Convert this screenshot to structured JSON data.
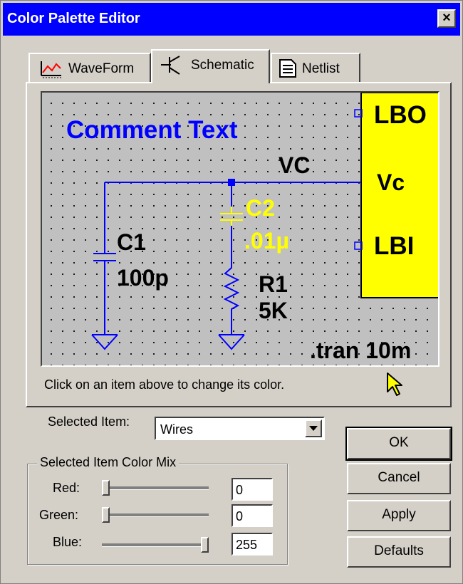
{
  "window": {
    "title": "Color Palette Editor",
    "close_glyph": "×"
  },
  "tabs": [
    {
      "label": "WaveForm",
      "icon": "waveform-icon",
      "active": false
    },
    {
      "label": "Schematic",
      "icon": "schematic-icon",
      "active": true
    },
    {
      "label": "Netlist",
      "icon": "netlist-icon",
      "active": false
    }
  ],
  "schematic": {
    "comment": "Comment Text",
    "net_label": "VC",
    "c1_name": "C1",
    "c1_value": "100p",
    "c2_name": "C2",
    "c2_value": ".01µ",
    "r1_name": "R1",
    "r1_value": "5K",
    "directive": ".tran 10m",
    "port_lbo": "LBO",
    "port_vc": "Vc",
    "port_lbi": "LBI",
    "colors": {
      "background": "#c0c0c0",
      "wire": "#0000ff",
      "comment": "#0000ff",
      "component": "#0000ff",
      "highlight": "#ffff00",
      "text": "#000000"
    }
  },
  "hint": "Click on an item above to change its color.",
  "selected_item": {
    "label": "Selected Item:",
    "value": "Wires"
  },
  "color_mix": {
    "title": "Selected Item Color Mix",
    "red": {
      "label": "Red:",
      "value": "0",
      "level": 0
    },
    "green": {
      "label": "Green:",
      "value": "0",
      "level": 0
    },
    "blue": {
      "label": "Blue:",
      "value": "255",
      "level": 1
    }
  },
  "buttons": {
    "ok": "OK",
    "cancel": "Cancel",
    "apply": "Apply",
    "defaults": "Defaults"
  }
}
